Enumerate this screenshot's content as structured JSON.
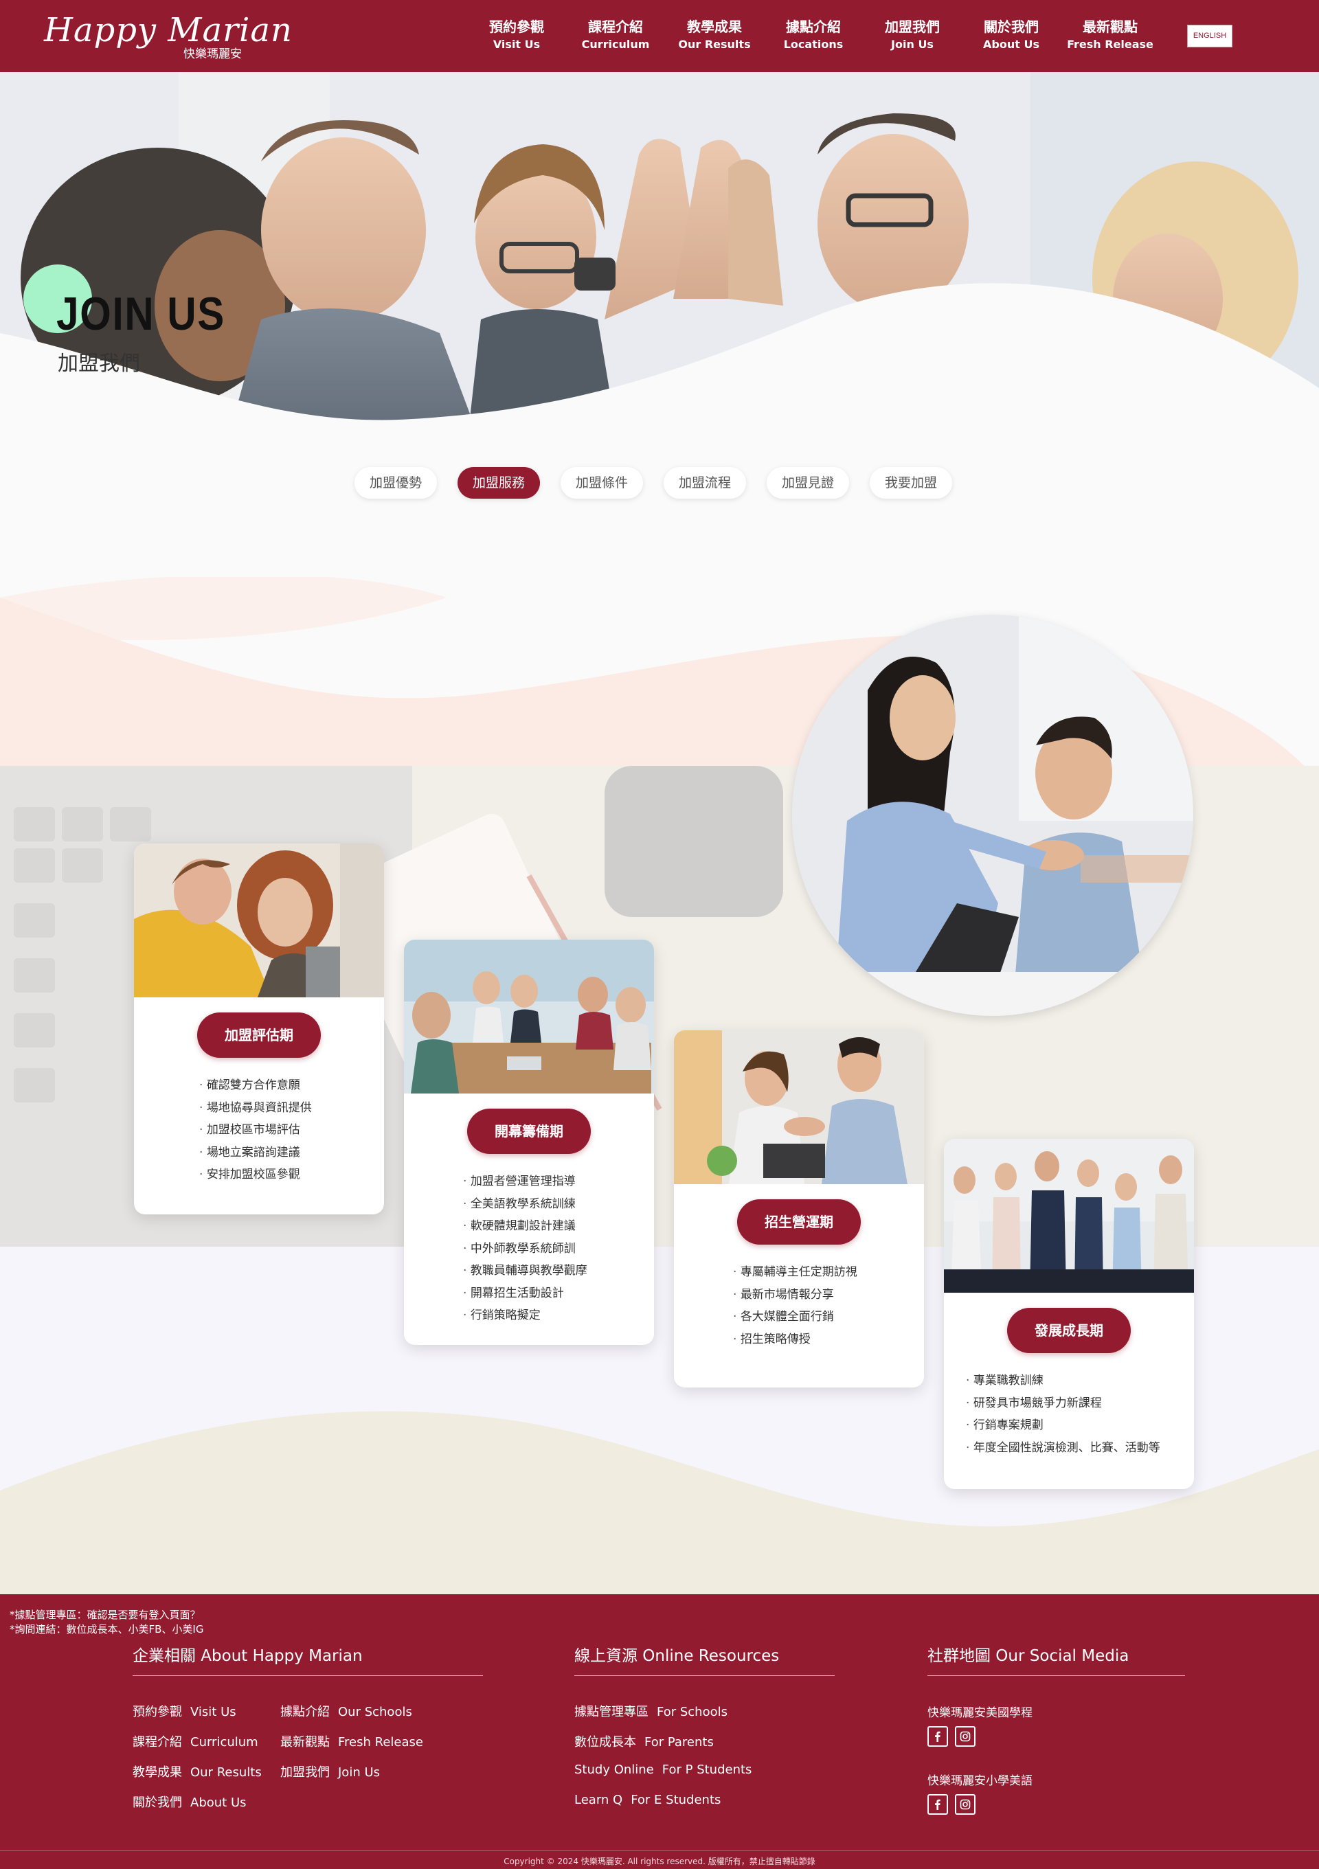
{
  "header": {
    "logo_script": "Happy Marian",
    "logo_sub": "快樂瑪麗安",
    "nav": [
      {
        "zh": "預約參觀",
        "en": "Visit Us"
      },
      {
        "zh": "課程介紹",
        "en": "Curriculum"
      },
      {
        "zh": "教學成果",
        "en": "Our Results"
      },
      {
        "zh": "據點介紹",
        "en": "Locations"
      },
      {
        "zh": "加盟我們",
        "en": "Join Us"
      },
      {
        "zh": "關於我們",
        "en": "About Us"
      },
      {
        "zh": "最新觀點",
        "en": "Fresh Release"
      }
    ],
    "lang_button": "ENGLISH"
  },
  "hero": {
    "title": "JOIN US",
    "subtitle": "加盟我們"
  },
  "tabs": [
    {
      "label": "加盟優勢",
      "active": false
    },
    {
      "label": "加盟服務",
      "active": true
    },
    {
      "label": "加盟條件",
      "active": false
    },
    {
      "label": "加盟流程",
      "active": false
    },
    {
      "label": "加盟見證",
      "active": false
    },
    {
      "label": "我要加盟",
      "active": false
    }
  ],
  "cards": [
    {
      "title": "加盟評估期",
      "items": [
        "確認雙方合作意願",
        "場地協尋與資訊提供",
        "加盟校區市場評估",
        "場地立案諮詢建議",
        "安排加盟校區參觀"
      ]
    },
    {
      "title": "開幕籌備期",
      "items": [
        "加盟者營運管理指導",
        "全美語教學系統訓練",
        "軟硬體規劃設計建議",
        "中外師教學系統師訓",
        "教職員輔導與教學觀摩",
        "開幕招生活動設計",
        "行銷策略擬定"
      ]
    },
    {
      "title": "招生營運期",
      "items": [
        "專屬輔導主任定期訪視",
        "最新市場情報分享",
        "各大媒體全面行銷",
        "招生策略傳授"
      ]
    },
    {
      "title": "發展成長期",
      "items": [
        "專業職教訓練",
        "研發具市場競爭力新課程",
        "行銷專案規劃",
        "年度全國性說演檢測、比賽、活動等"
      ]
    }
  ],
  "footer": {
    "notes": [
      "*據點管理專區：確認是否要有登入頁面？",
      "*詢問連結：數位成長本、小美FB、小美IG"
    ],
    "about": {
      "title": "企業相關 About Happy Marian",
      "links": [
        {
          "zh": "預約參觀",
          "en": "Visit Us"
        },
        {
          "zh": "課程介紹",
          "en": "Curriculum"
        },
        {
          "zh": "教學成果",
          "en": "Our Results"
        },
        {
          "zh": "關於我們",
          "en": "About Us"
        },
        {
          "zh": "據點介紹",
          "en": "Our Schools"
        },
        {
          "zh": "最新觀點",
          "en": "Fresh Release"
        },
        {
          "zh": "加盟我們",
          "en": "Join Us"
        }
      ]
    },
    "resources": {
      "title": "線上資源 Online Resources",
      "links": [
        {
          "zh": "據點管理專區",
          "en": "For Schools"
        },
        {
          "zh": "數位成長本",
          "en": "For Parents"
        },
        {
          "zh": "Study Online",
          "en": "For P Students"
        },
        {
          "zh": "Learn Q",
          "en": "For E Students"
        }
      ]
    },
    "social": {
      "title": "社群地圖 Our Social Media",
      "groups": [
        {
          "label": "快樂瑪麗安美國學程"
        },
        {
          "label": "快樂瑪麗安小學美語"
        }
      ]
    },
    "copyright": "Copyright © 2024 快樂瑪麗安. All rights reserved. 版權所有，禁止擅自轉貼節錄"
  },
  "colors": {
    "brand": "#931b30",
    "accent_mint": "#a6f2c9",
    "peach": "#fbebe4",
    "cream": "#f1ece0"
  },
  "icons": [
    "facebook-icon",
    "instagram-icon"
  ]
}
